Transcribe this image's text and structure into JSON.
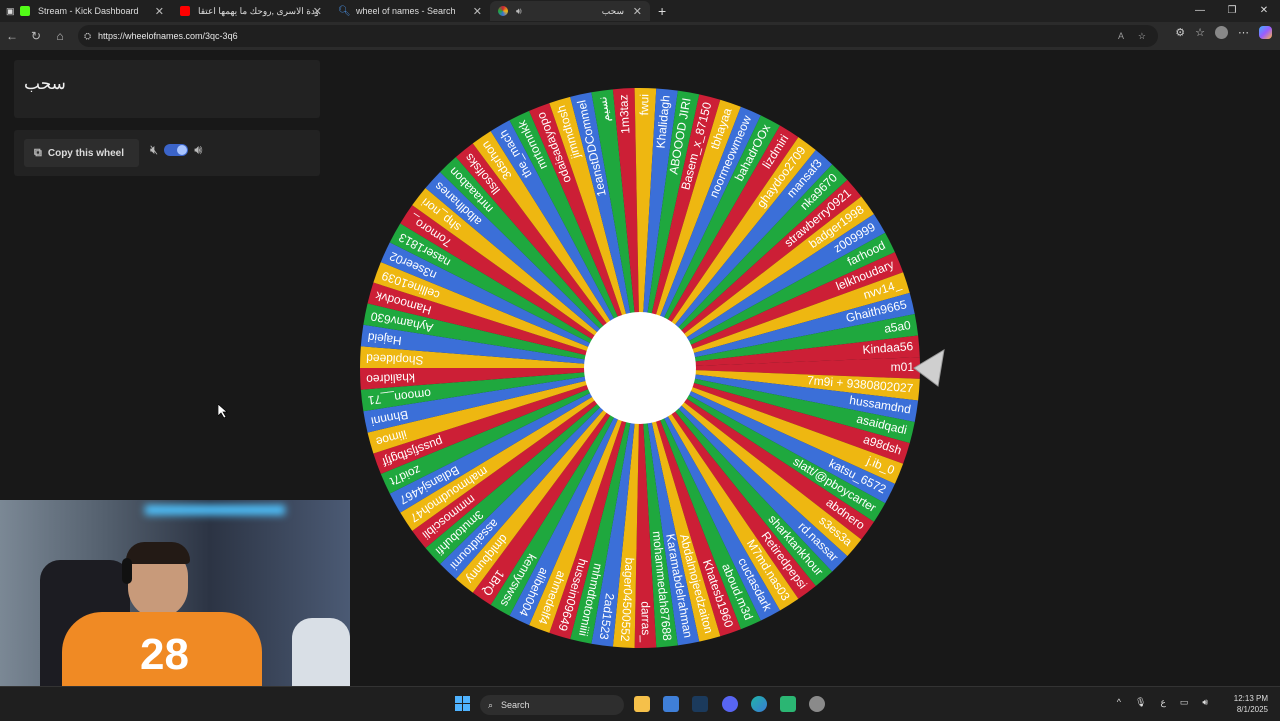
{
  "browser": {
    "tabs": [
      {
        "label": "Stream - Kick Dashboard",
        "color": "#53fc18"
      },
      {
        "label": "انشودة الاسرى ,روحك ما يهمها اعتقا",
        "color": "#ff0000"
      },
      {
        "label": "wheel of names - Search",
        "color": "#3b82f6"
      },
      {
        "label": "سحب",
        "color": "#e9a93b"
      }
    ],
    "url": "https://wheelofnames.com/3qc-3q6"
  },
  "sidebar": {
    "wheel_title": "سحب",
    "copy_button_label": "Copy this wheel"
  },
  "wheel": {
    "segment_colors": [
      "#cc1f36",
      "#eeb711",
      "#3b6fd8",
      "#1fa83e"
    ],
    "entries": [
      "m01",
      "7m9i + 9380802027",
      "hussamdnd",
      "asaidqadi",
      "a98dsh",
      "j.ib_0",
      "katsu_6572",
      "slatt/@pboycarter",
      "abdnero",
      "s3es3a",
      "rd.nassar",
      "sharktankhour",
      "Retiredpepsi",
      "M7md.nas03",
      "cuctasdark",
      "aboud.m3d",
      "Khatesb1960",
      "Abdalmojeedzaiton",
      "Karamabdelrahman",
      "mohammedah87688",
      "darras_",
      "bager04500552",
      "2ad1523",
      "mhmdtotomiiii",
      "hussein09649",
      "ahmedelf4",
      "alibeh004",
      "kennyswss",
      "1BrQ",
      "dmlqbunny",
      "assaidtoumi",
      "3mutobuhfi",
      "mmmoscibli",
      "mahmoudmoh47",
      "Bdlansj4467",
      "zoid7t",
      "pussfjsfbgfjf",
      "ilimoe",
      "Bhnnni",
      "omoon__71",
      "khalidreo",
      "Shopldeed",
      "Hajeid",
      "Ayhamv630",
      "Hamoodvk",
      "celline1039",
      "n3seer02",
      "naser1813",
      "7omoro_",
      "shp_nori",
      "albdlhanes",
      "mrtaaabon",
      "llssolfsks",
      "3dsrhon",
      "the_mach",
      "mrtomnkk",
      "odaisadayopo",
      "jimmdtosh",
      "1eanstDDCommel",
      "نسيم",
      "1m3taz",
      "fwui",
      "Khalidagh",
      "ABOOOD JIRI",
      "Basem_x_87150",
      "tbhayaa",
      "noormeowmeow",
      "bahadrOOx",
      "lizdmiri",
      "ghaydoo2709",
      "mansaf3",
      "nka9670",
      "strawberry0921",
      "badger1998",
      "z009999",
      "farhood",
      "lelkhoudary",
      "nvv14_",
      "Ghaith9665",
      "a5a0",
      "Kindaa56"
    ]
  },
  "taskbar": {
    "search_label": "Search",
    "time": "12:13 PM",
    "date": "8/1/2025",
    "lang": "ع"
  }
}
